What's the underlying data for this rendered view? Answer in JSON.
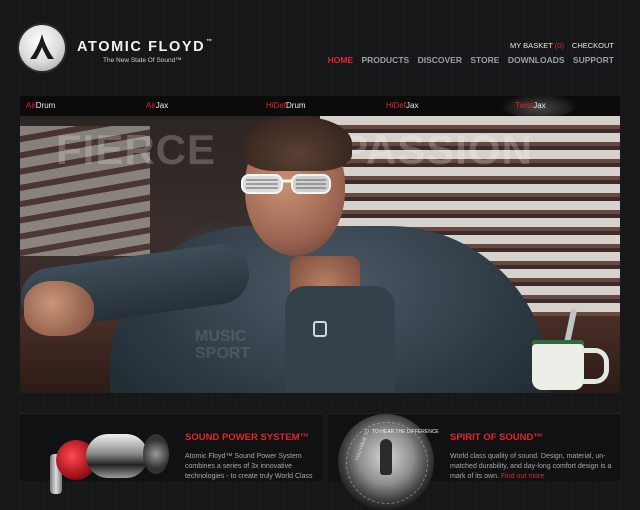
{
  "brand": {
    "name": "ATOMIC FLOYD",
    "trademark": "™",
    "tagline": "The New State Of Sound™"
  },
  "utility": {
    "basket_label": "MY BASKET",
    "basket_count": "(0)",
    "checkout_label": "CHECKOUT"
  },
  "nav": [
    {
      "label": "HOME",
      "active": true
    },
    {
      "label": "PRODUCTS",
      "active": false
    },
    {
      "label": "DISCOVER",
      "active": false
    },
    {
      "label": "STORE",
      "active": false
    },
    {
      "label": "DOWNLOADS",
      "active": false
    },
    {
      "label": "SUPPORT",
      "active": false
    }
  ],
  "product_tabs": [
    {
      "accent": "Air",
      "rest": "Drum"
    },
    {
      "accent": "Air",
      "rest": "Jax"
    },
    {
      "accent": "HiDef",
      "rest": "Drum"
    },
    {
      "accent": "HiDef",
      "rest": "Jax"
    },
    {
      "accent": "Twist",
      "rest": "Jax"
    }
  ],
  "hero": {
    "title_left": "FIERCE",
    "title_right": "PASSION",
    "ghost_line1": "MUSIC",
    "ghost_line2": "SPORT"
  },
  "panels": {
    "left": {
      "title": "SOUND POWER SYSTEM™",
      "body": "Atomic Floyd™ Sound Power System combines a series of 3x innovative technologies - to create truly World Class"
    },
    "right": {
      "title": "SPIRIT OF SOUND™",
      "body": "World class quality of sound. Design, material, un-matched durability, and day-long comfort",
      "body_more": "design is a mark of its own.",
      "link": "Find out more",
      "coin_top": "TO HEAR THE DIFFERENCE",
      "coin_side": "YOU HAVE TO"
    }
  },
  "colors": {
    "accent": "#e0262c",
    "background": "#151617",
    "nav_inactive": "#9a9fa6"
  }
}
